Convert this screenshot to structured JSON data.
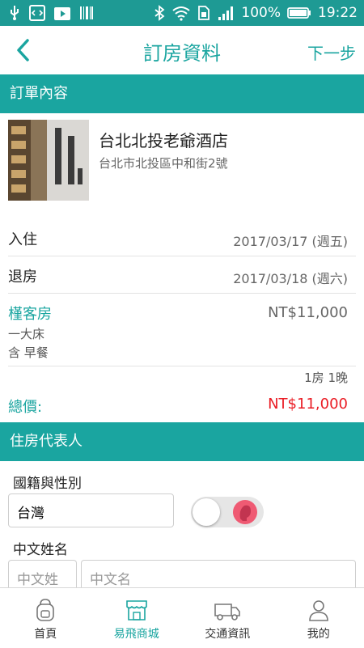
{
  "status_bar": {
    "battery": "100%",
    "time": "19:22"
  },
  "header": {
    "title": "訂房資料",
    "next_label": "下一步"
  },
  "order_section": {
    "title": "訂單內容"
  },
  "hotel": {
    "name": "台北北投老爺酒店",
    "address": "台北市北投區中和街2號"
  },
  "checkin": {
    "label": "入住",
    "value": "2017/03/17 (週五)"
  },
  "checkout": {
    "label": "退房",
    "value": "2017/03/18 (週六)"
  },
  "room": {
    "type": "槿客房",
    "price": "NT$11,000",
    "bed": "一大床",
    "meal": "含 早餐",
    "qty": "1房 1晚"
  },
  "total": {
    "label": "總價:",
    "value": "NT$11,000"
  },
  "guest_section": {
    "title": "住房代表人"
  },
  "nationality": {
    "label": "國籍與性別",
    "value": "台灣"
  },
  "chinese_name": {
    "label": "中文姓名",
    "surname_placeholder": "中文姓",
    "given_placeholder": "中文名"
  },
  "tabs": [
    {
      "label": "首頁",
      "icon": "backpack-icon"
    },
    {
      "label": "易飛商城",
      "icon": "shop-icon"
    },
    {
      "label": "交通資訊",
      "icon": "van-icon"
    },
    {
      "label": "我的",
      "icon": "person-icon"
    }
  ],
  "colors": {
    "accent": "#1aa5a0",
    "status_bar": "#1e9a94",
    "total_price": "#ea1c24"
  }
}
